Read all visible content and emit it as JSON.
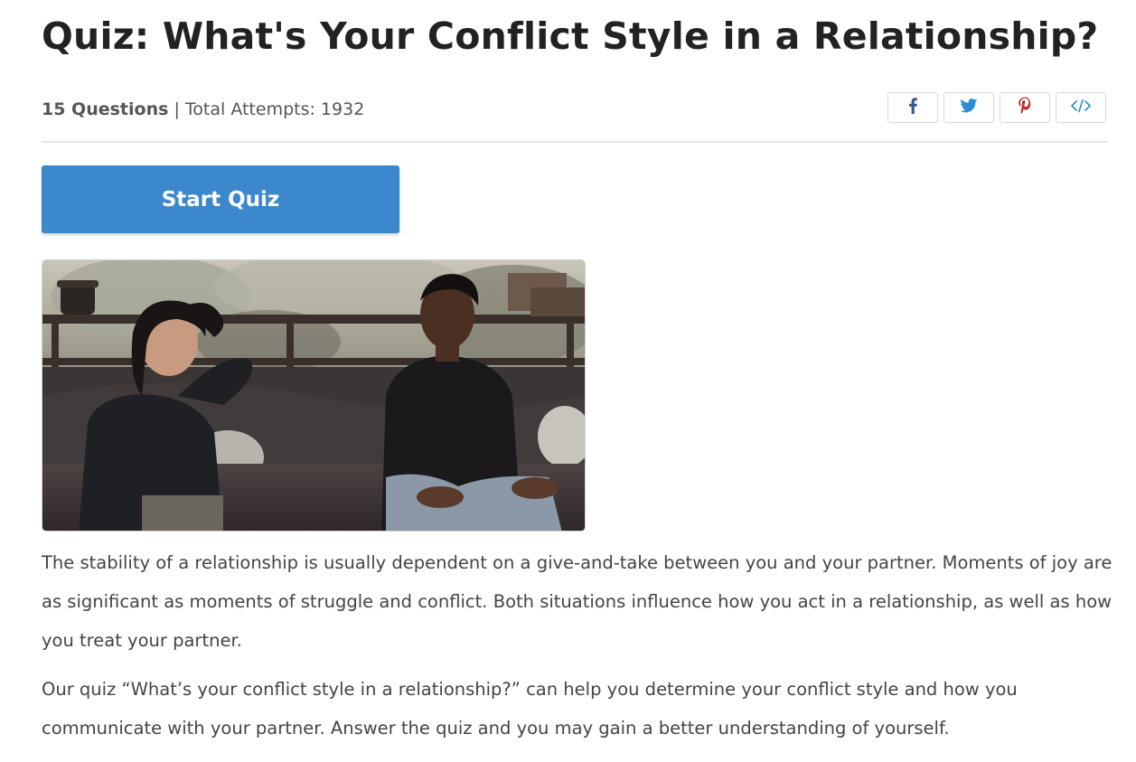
{
  "quiz": {
    "title": "Quiz: What's Your Conflict Style in a Relationship?",
    "question_count": "15 Questions",
    "separator": " | ",
    "attempts": "Total Attempts: 1932",
    "start_label": "Start Quiz"
  },
  "share": {
    "buttons": [
      {
        "icon": "facebook-icon",
        "color": "#3b5998"
      },
      {
        "icon": "twitter-icon",
        "color": "#2a8ed0"
      },
      {
        "icon": "pinterest-icon",
        "color": "#bd2a2a"
      },
      {
        "icon": "embed-code-icon",
        "color": "#2a8ed0"
      }
    ]
  },
  "colors": {
    "accent": "#3b88cc",
    "title": "#222222",
    "body_text": "#444444",
    "divider": "#e6e6e6"
  },
  "hero_image": {
    "icon": "couple-conversation-photo"
  },
  "description": {
    "paragraph_1": "The stability of a relationship is usually dependent on a give-and-take between you and your partner. Moments of joy are as significant as moments of struggle and conflict. Both situations influence how you act in a relationship, as well as how you treat your partner.",
    "paragraph_2": "Our quiz “What’s your conflict style in a relationship?” can help you determine your conflict style and how you communicate with your partner. Answer the quiz and you may gain a better understanding of yourself."
  }
}
